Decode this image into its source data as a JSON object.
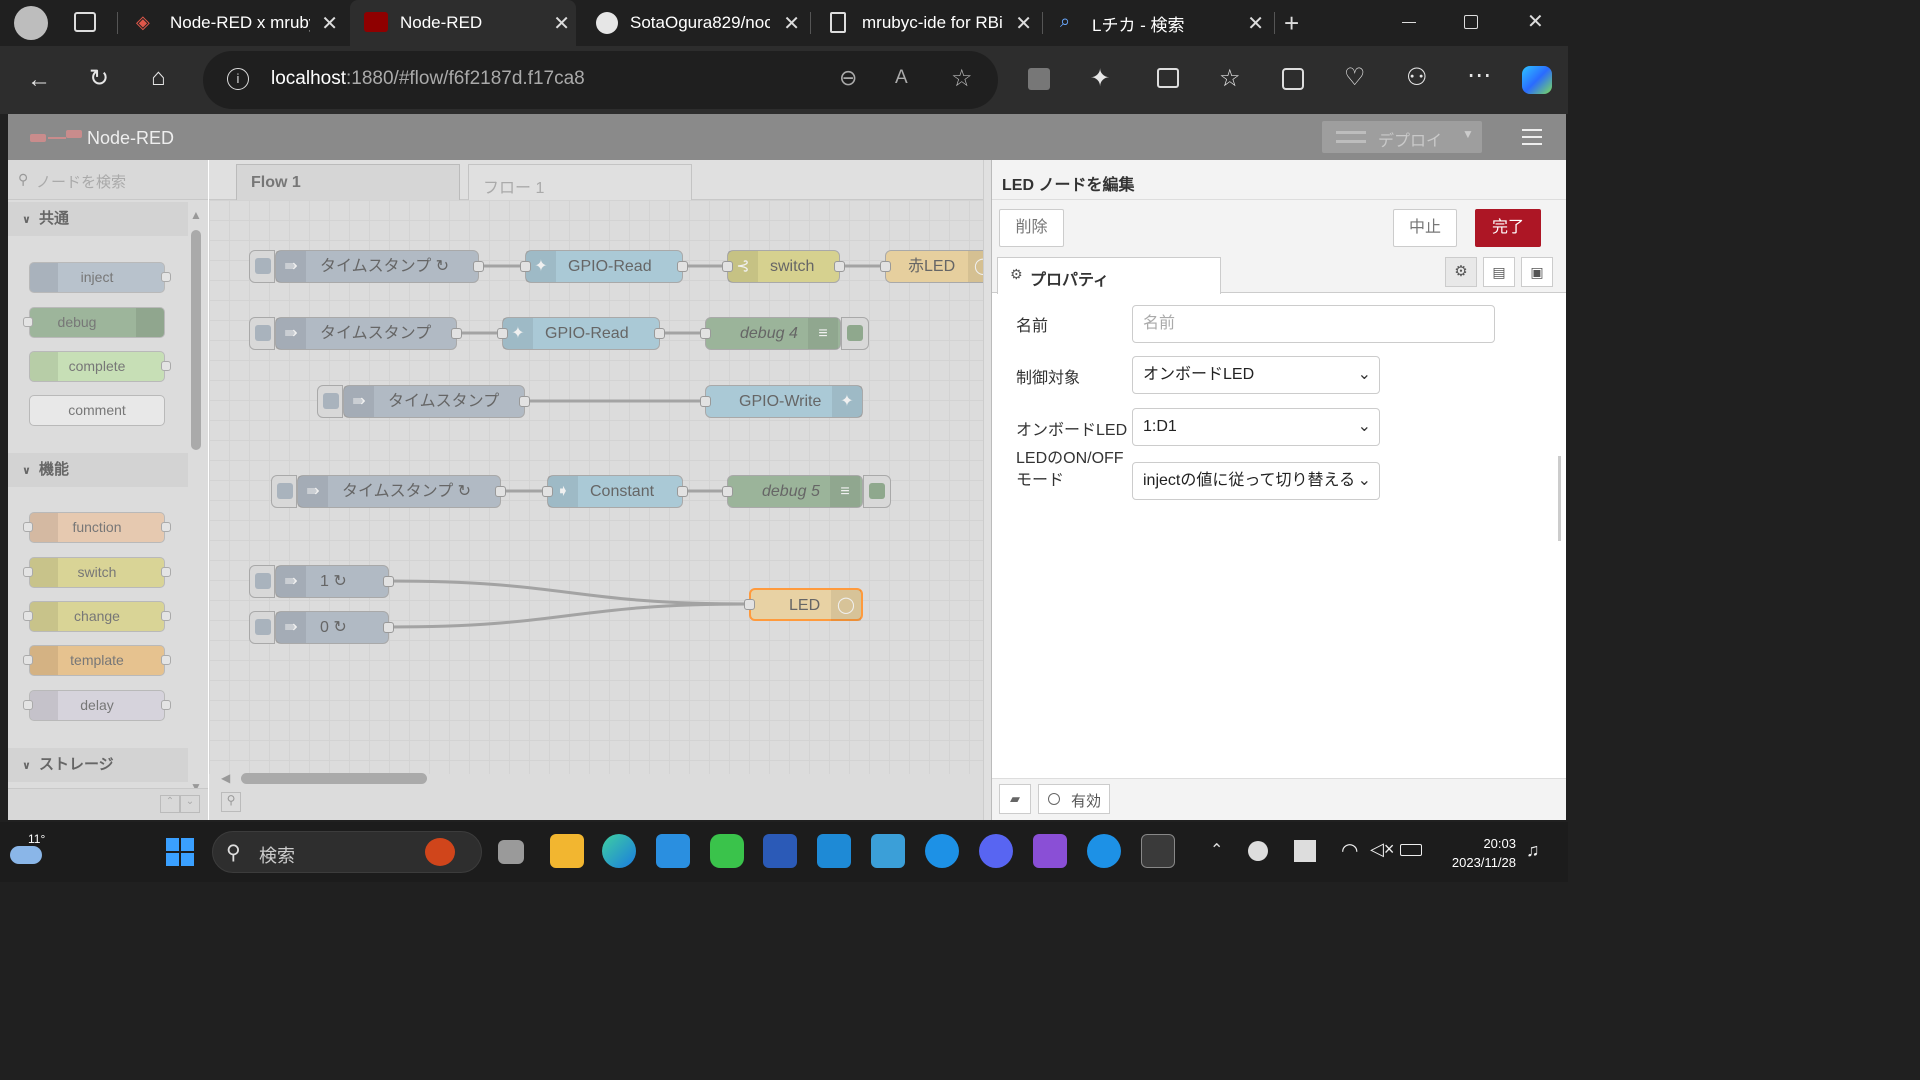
{
  "browser": {
    "tabs": [
      {
        "title": "Node-RED x mruby"
      },
      {
        "title": "Node-RED"
      },
      {
        "title": "SotaOgura829/noc"
      },
      {
        "title": "mrubyc-ide for RBi"
      },
      {
        "title": "Lチカ - 検索"
      }
    ],
    "url_host": "localhost",
    "url_rest": ":1880/#flow/f6f2187d.f17ca8"
  },
  "nodered": {
    "title": "Node-RED",
    "deploy_label": "デプロイ",
    "search_placeholder": "ノードを検索",
    "flow_tabs": [
      "Flow 1",
      "フロー 1"
    ],
    "palette": {
      "cat_common": "共通",
      "cat_function": "機能",
      "cat_storage": "ストレージ",
      "common": [
        "inject",
        "debug",
        "complete",
        "comment"
      ],
      "function": [
        "function",
        "switch",
        "change",
        "template",
        "delay"
      ]
    },
    "flow_nodes": {
      "ts1": "タイムスタンプ ↻",
      "gr1": "GPIO-Read",
      "sw1": "switch",
      "redled": "赤LED",
      "ts2": "タイムスタンプ",
      "gr2": "GPIO-Read",
      "dbg4": "debug 4",
      "ts3": "タイムスタンプ",
      "gw": "GPIO-Write",
      "ts4": "タイムスタンプ ↻",
      "const": "Constant",
      "dbg5": "debug 5",
      "in1": "1 ↻",
      "in0": "0 ↻",
      "led": "LED"
    },
    "edit": {
      "title": "LED ノードを編集",
      "delete": "削除",
      "cancel": "中止",
      "done": "完了",
      "tab_props": "プロパティ",
      "name_label": "名前",
      "name_placeholder": "名前",
      "target_label": "制御対象",
      "target_value": "オンボードLED",
      "onboard_label": "オンボードLED",
      "onboard_value": "1:D1",
      "mode_label": "LEDのON/OFF\nモード",
      "mode_value": "injectの値に従って切り替える",
      "enabled": "有効"
    }
  },
  "taskbar": {
    "weather": "11°",
    "search": "検索",
    "time": "20:03",
    "date": "2023/11/28"
  }
}
